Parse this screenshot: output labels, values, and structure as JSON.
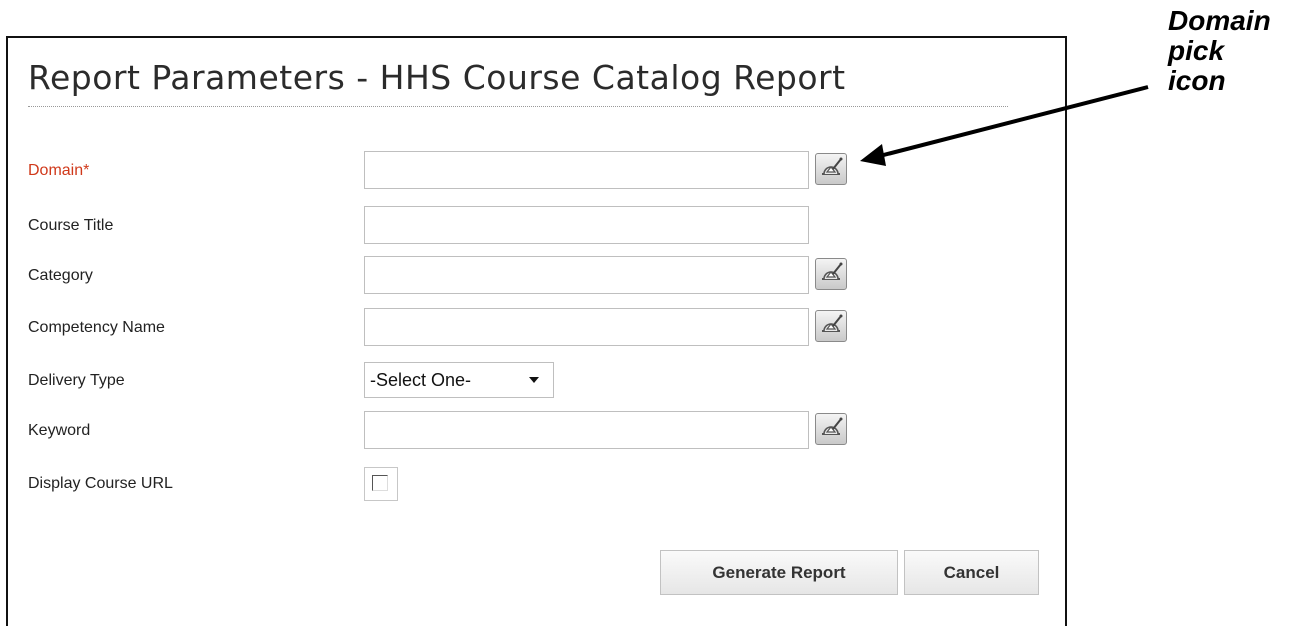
{
  "title": "Report Parameters - HHS Course Catalog Report",
  "fields": {
    "domain": {
      "label": "Domain*",
      "value": ""
    },
    "course_title": {
      "label": "Course Title",
      "value": ""
    },
    "category": {
      "label": "Category",
      "value": ""
    },
    "competency_name": {
      "label": "Competency Name",
      "value": ""
    },
    "delivery_type": {
      "label": "Delivery Type",
      "selected": "-Select One-"
    },
    "keyword": {
      "label": "Keyword",
      "value": ""
    },
    "display_course_url": {
      "label": "Display Course URL",
      "checked": false
    }
  },
  "buttons": {
    "generate": "Generate Report",
    "cancel": "Cancel"
  },
  "annotation": {
    "lines": [
      "Domain",
      "pick",
      "icon"
    ]
  },
  "colors": {
    "required_label": "#d0391b",
    "title": "#2b2b2b"
  },
  "icons": {
    "pick": "domain-pick-icon"
  }
}
